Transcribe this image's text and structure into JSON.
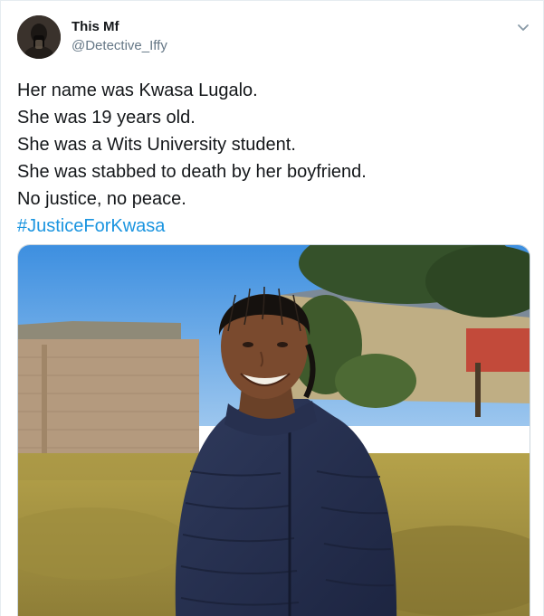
{
  "tweet": {
    "author_name": "This Mf",
    "author_handle": "@Detective_Iffy",
    "lines": [
      "Her name was Kwasa Lugalo.",
      "She was 19 years old.",
      "She was a Wits University student.",
      "She was stabbed to death by her boyfriend.",
      "No justice, no peace."
    ],
    "hashtag": "#JusticeForKwasa"
  },
  "icons": {
    "menu": "chevron-down-icon",
    "avatar": "avatar-photo"
  },
  "colors": {
    "link": "#1b95e0",
    "secondary_text": "#657786",
    "primary_text": "#14171a"
  }
}
